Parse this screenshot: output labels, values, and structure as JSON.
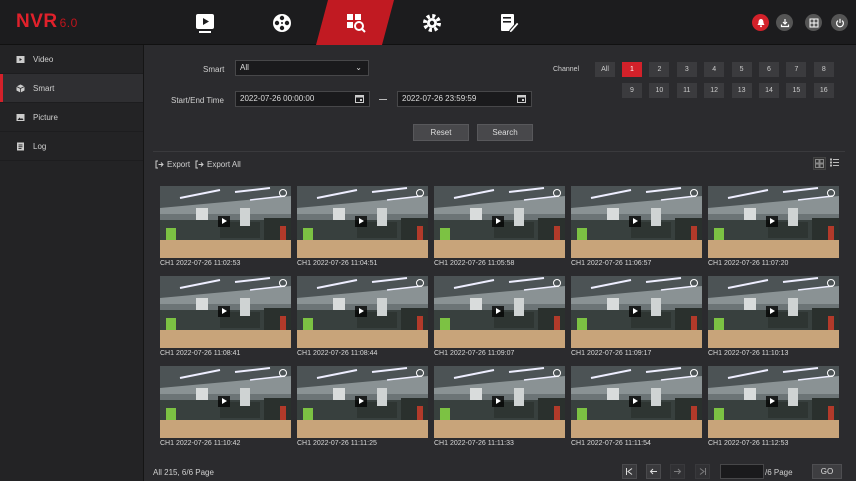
{
  "app": {
    "logo": "NVR",
    "version": "6.0"
  },
  "topnav": [
    {
      "name": "playback-icon"
    },
    {
      "name": "film-reel-icon"
    },
    {
      "name": "smart-search-icon",
      "active": true
    },
    {
      "name": "gear-icon"
    },
    {
      "name": "edit-log-icon"
    }
  ],
  "sidebar": {
    "items": [
      {
        "label": "Video",
        "icon": "video-icon"
      },
      {
        "label": "Smart",
        "icon": "smart-icon",
        "active": true
      },
      {
        "label": "Picture",
        "icon": "picture-icon"
      },
      {
        "label": "Log",
        "icon": "log-icon"
      }
    ]
  },
  "filters": {
    "smart_label": "Smart",
    "smart_value": "All",
    "time_label": "Start/End Time",
    "start_time": "2022-07-26 00:00:00",
    "end_time": "2022-07-26 23:59:59",
    "reset": "Reset",
    "search": "Search"
  },
  "channels": {
    "label": "Channel",
    "all": "All",
    "items": [
      "1",
      "2",
      "3",
      "4",
      "5",
      "6",
      "7",
      "8",
      "9",
      "10",
      "11",
      "12",
      "13",
      "14",
      "15",
      "16"
    ],
    "selected": "1"
  },
  "export": {
    "export": "Export",
    "export_all": "Export All"
  },
  "results": [
    "CH1 2022-07-26 11:02:53",
    "CH1 2022-07-26 11:04:51",
    "CH1 2022-07-26 11:05:58",
    "CH1 2022-07-26 11:06:57",
    "CH1 2022-07-26 11:07:20",
    "CH1 2022-07-26 11:08:41",
    "CH1 2022-07-26 11:08:44",
    "CH1 2022-07-26 11:09:07",
    "CH1 2022-07-26 11:09:17",
    "CH1 2022-07-26 11:10:13",
    "CH1 2022-07-26 11:10:42",
    "CH1 2022-07-26 11:11:25",
    "CH1 2022-07-26 11:11:33",
    "CH1 2022-07-26 11:11:54",
    "CH1 2022-07-26 11:12:53"
  ],
  "pager": {
    "info": "All 215, 6/6 Page",
    "page_suffix": "/6 Page",
    "go": "GO",
    "page_input": ""
  },
  "colors": {
    "accent": "#d3212a",
    "background": "#2b2b2e",
    "topbar": "#1c1c1e"
  }
}
